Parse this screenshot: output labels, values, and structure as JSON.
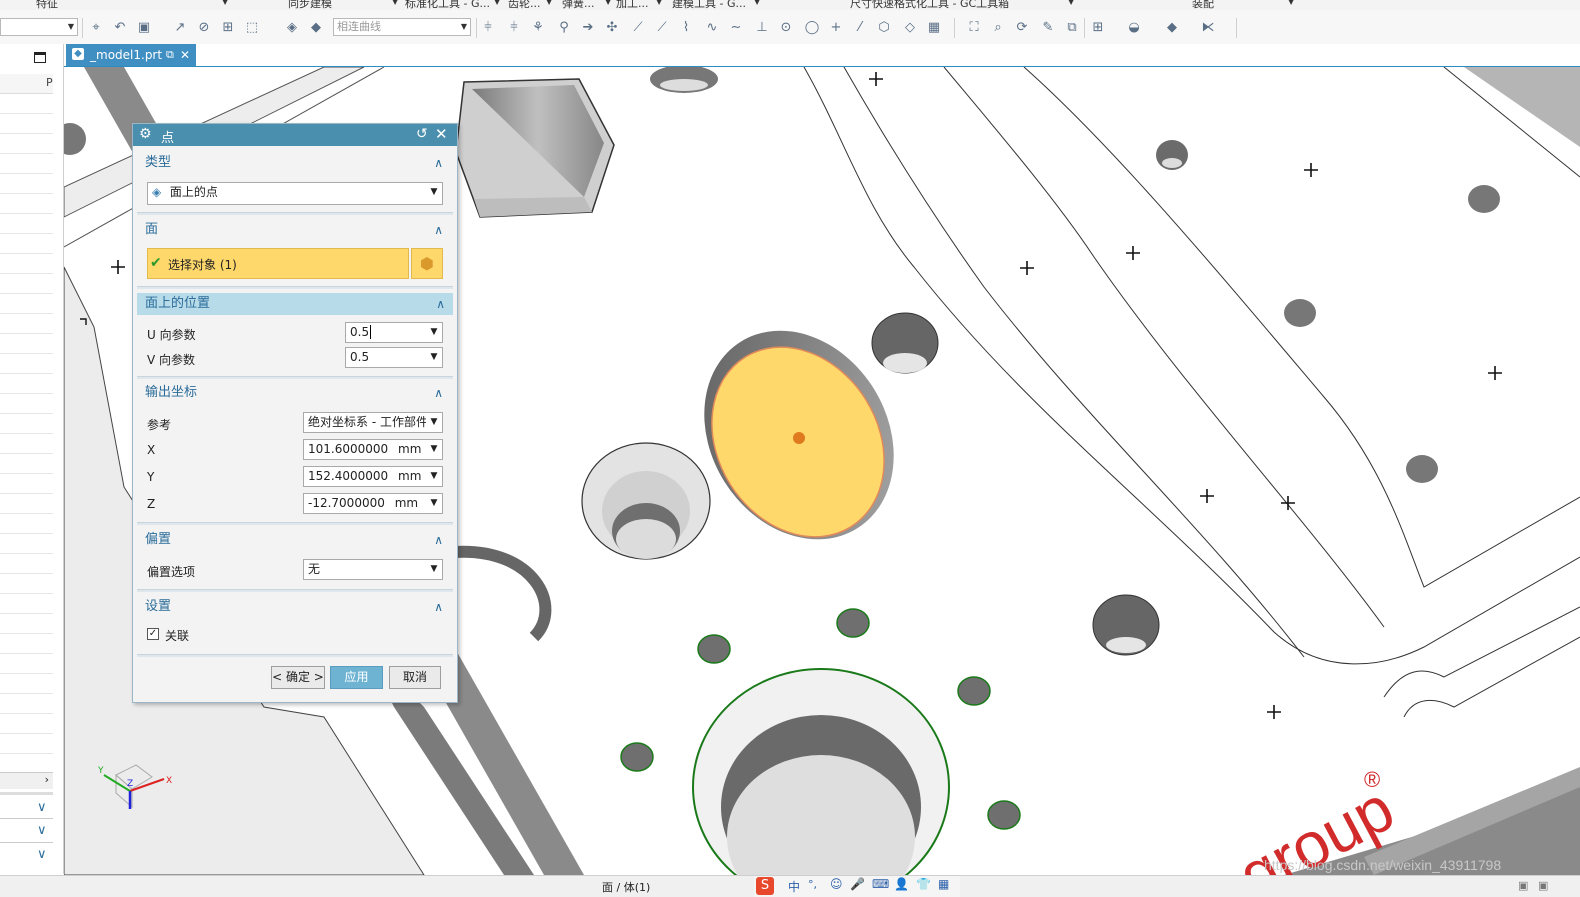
{
  "ribbon": {
    "labels": [
      "特征",
      "同步建模",
      "标准化工具 - G...",
      "齿轮...",
      "弹簧...",
      "加工...",
      "建模工具 - G...",
      "尺寸快速格式化工具 - GC工具箱",
      "装配"
    ]
  },
  "toolbar": {
    "curve_filter_value": "相连曲线"
  },
  "tab": {
    "filename": "_model1.prt"
  },
  "left_panel": {
    "header_label": "P"
  },
  "dialog": {
    "title": "点",
    "sections": {
      "type": {
        "header": "类型",
        "selected": "面上的点"
      },
      "face": {
        "header": "面",
        "select_label": "选择对象 (1)"
      },
      "position": {
        "header": "面上的位置",
        "u_label": "U 向参数",
        "u_value": "0.5",
        "v_label": "V 向参数",
        "v_value": "0.5"
      },
      "output": {
        "header": "输出坐标",
        "reference_label": "参考",
        "reference_value": "绝对坐标系 - 工作部件",
        "x_label": "X",
        "x_value": "101.6000000",
        "y_label": "Y",
        "y_value": "152.4000000",
        "z_label": "Z",
        "z_value": "-12.7000000",
        "unit": "mm"
      },
      "offset": {
        "header": "偏置",
        "option_label": "偏置选项",
        "option_value": "无"
      },
      "settings": {
        "header": "设置",
        "associative_label": "关联",
        "associative_checked": true
      }
    },
    "buttons": {
      "ok": "< 确定 >",
      "apply": "应用",
      "cancel": "取消"
    }
  },
  "viewport": {
    "watermark": "group",
    "registered_mark": "®",
    "csdn_url": "https://blog.csdn.net/weixin_43911798",
    "highlight_color": "#ffd86b"
  },
  "status": {
    "selection_text": "面 / 体(1)",
    "ime_text": "中"
  },
  "triad": {
    "x": "X",
    "y": "Y",
    "z": "Z"
  }
}
